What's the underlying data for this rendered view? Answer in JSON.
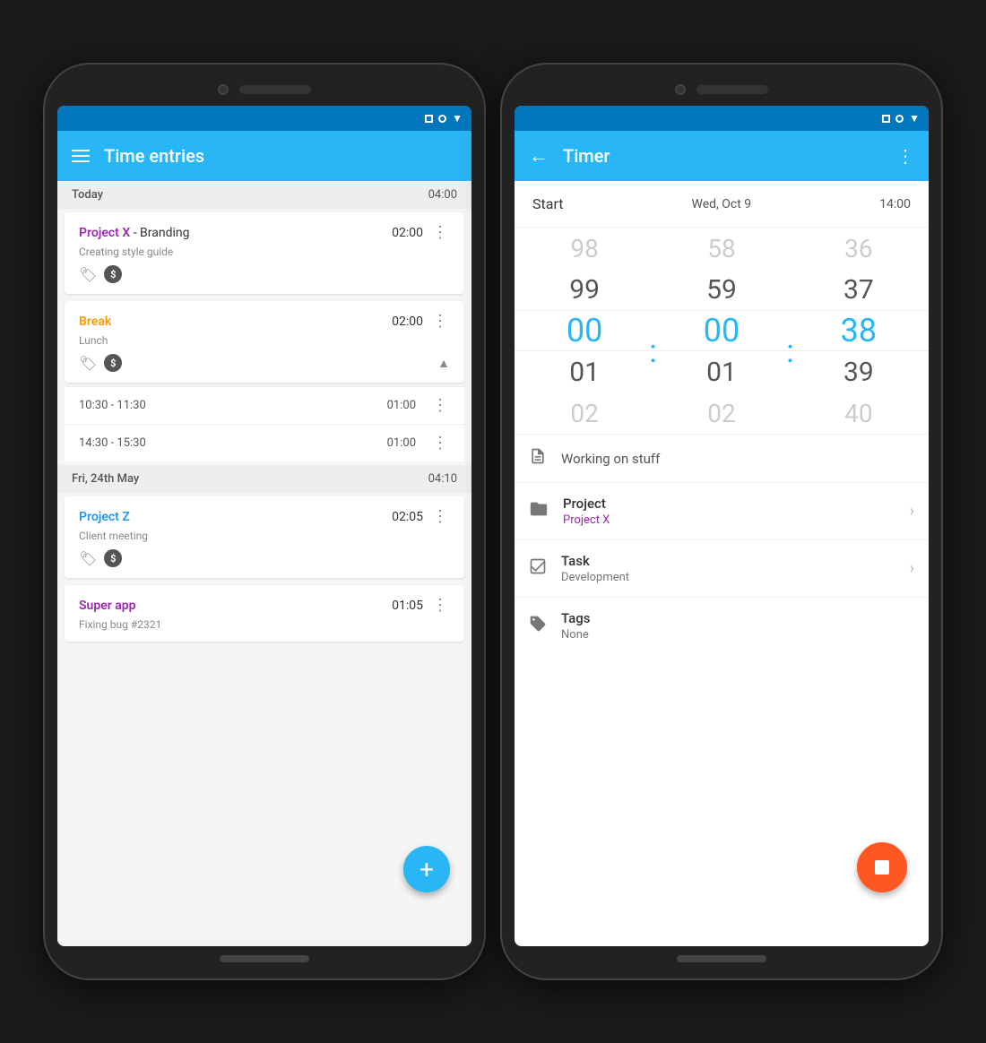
{
  "phone1": {
    "statusBar": {
      "icons": [
        "square",
        "circle",
        "wifi"
      ]
    },
    "appBar": {
      "title": "Time entries",
      "menuIcon": "hamburger"
    },
    "sections": [
      {
        "id": "today",
        "dateLabel": "Today",
        "total": "04:00",
        "entries": [
          {
            "id": "entry1",
            "projectName": "Project X",
            "projectClass": "project-x",
            "taskName": "Branding",
            "description": "Creating style guide",
            "duration": "02:00",
            "hasTag": true,
            "hasBillable": true,
            "expanded": false
          }
        ]
      },
      {
        "id": "break",
        "entries": [
          {
            "id": "entry2",
            "projectName": "Break",
            "projectClass": "project-break",
            "taskName": "",
            "description": "Lunch",
            "duration": "02:00",
            "hasTag": true,
            "hasBillable": true,
            "expanded": true,
            "subEntries": [
              {
                "timeRange": "10:30 - 11:30",
                "duration": "01:00"
              },
              {
                "timeRange": "14:30 - 15:30",
                "duration": "01:00"
              }
            ]
          }
        ]
      },
      {
        "id": "friday",
        "dateLabel": "Fri, 24th May",
        "total": "04:10",
        "entries": [
          {
            "id": "entry3",
            "projectName": "Project Z",
            "projectClass": "project-z",
            "taskName": "",
            "description": "Client meeting",
            "duration": "02:05",
            "hasTag": true,
            "hasBillable": true,
            "expanded": false
          },
          {
            "id": "entry4",
            "projectName": "Super app",
            "projectClass": "project-super",
            "taskName": "",
            "description": "Fixing bug #2321",
            "duration": "01:05",
            "hasTag": false,
            "hasBillable": false,
            "expanded": false
          }
        ]
      }
    ],
    "fab": {
      "label": "+"
    }
  },
  "phone2": {
    "statusBar": {
      "icons": [
        "square",
        "circle",
        "wifi"
      ]
    },
    "appBar": {
      "title": "Timer",
      "backIcon": "←",
      "moreIcon": "⋮"
    },
    "startRow": {
      "label": "Start",
      "date": "Wed, Oct 9",
      "time": "14:00"
    },
    "timePicker": {
      "hours": {
        "above2": "98",
        "above1": "99",
        "selected": "00",
        "below1": "01",
        "below2": "02"
      },
      "minutes": {
        "above2": "58",
        "above1": "59",
        "selected": "00",
        "below1": "01",
        "below2": "02"
      },
      "seconds": {
        "above2": "36",
        "above1": "37",
        "selected": "38",
        "below1": "39",
        "below2": "40"
      }
    },
    "noteRow": {
      "icon": "note",
      "text": "Working on stuff"
    },
    "projectRow": {
      "icon": "folder",
      "label": "Project",
      "value": "Project X"
    },
    "taskRow": {
      "icon": "task",
      "label": "Task",
      "value": "Development"
    },
    "tagsRow": {
      "icon": "tag",
      "label": "Tags",
      "value": "None"
    },
    "stopFab": {
      "label": "stop"
    }
  }
}
